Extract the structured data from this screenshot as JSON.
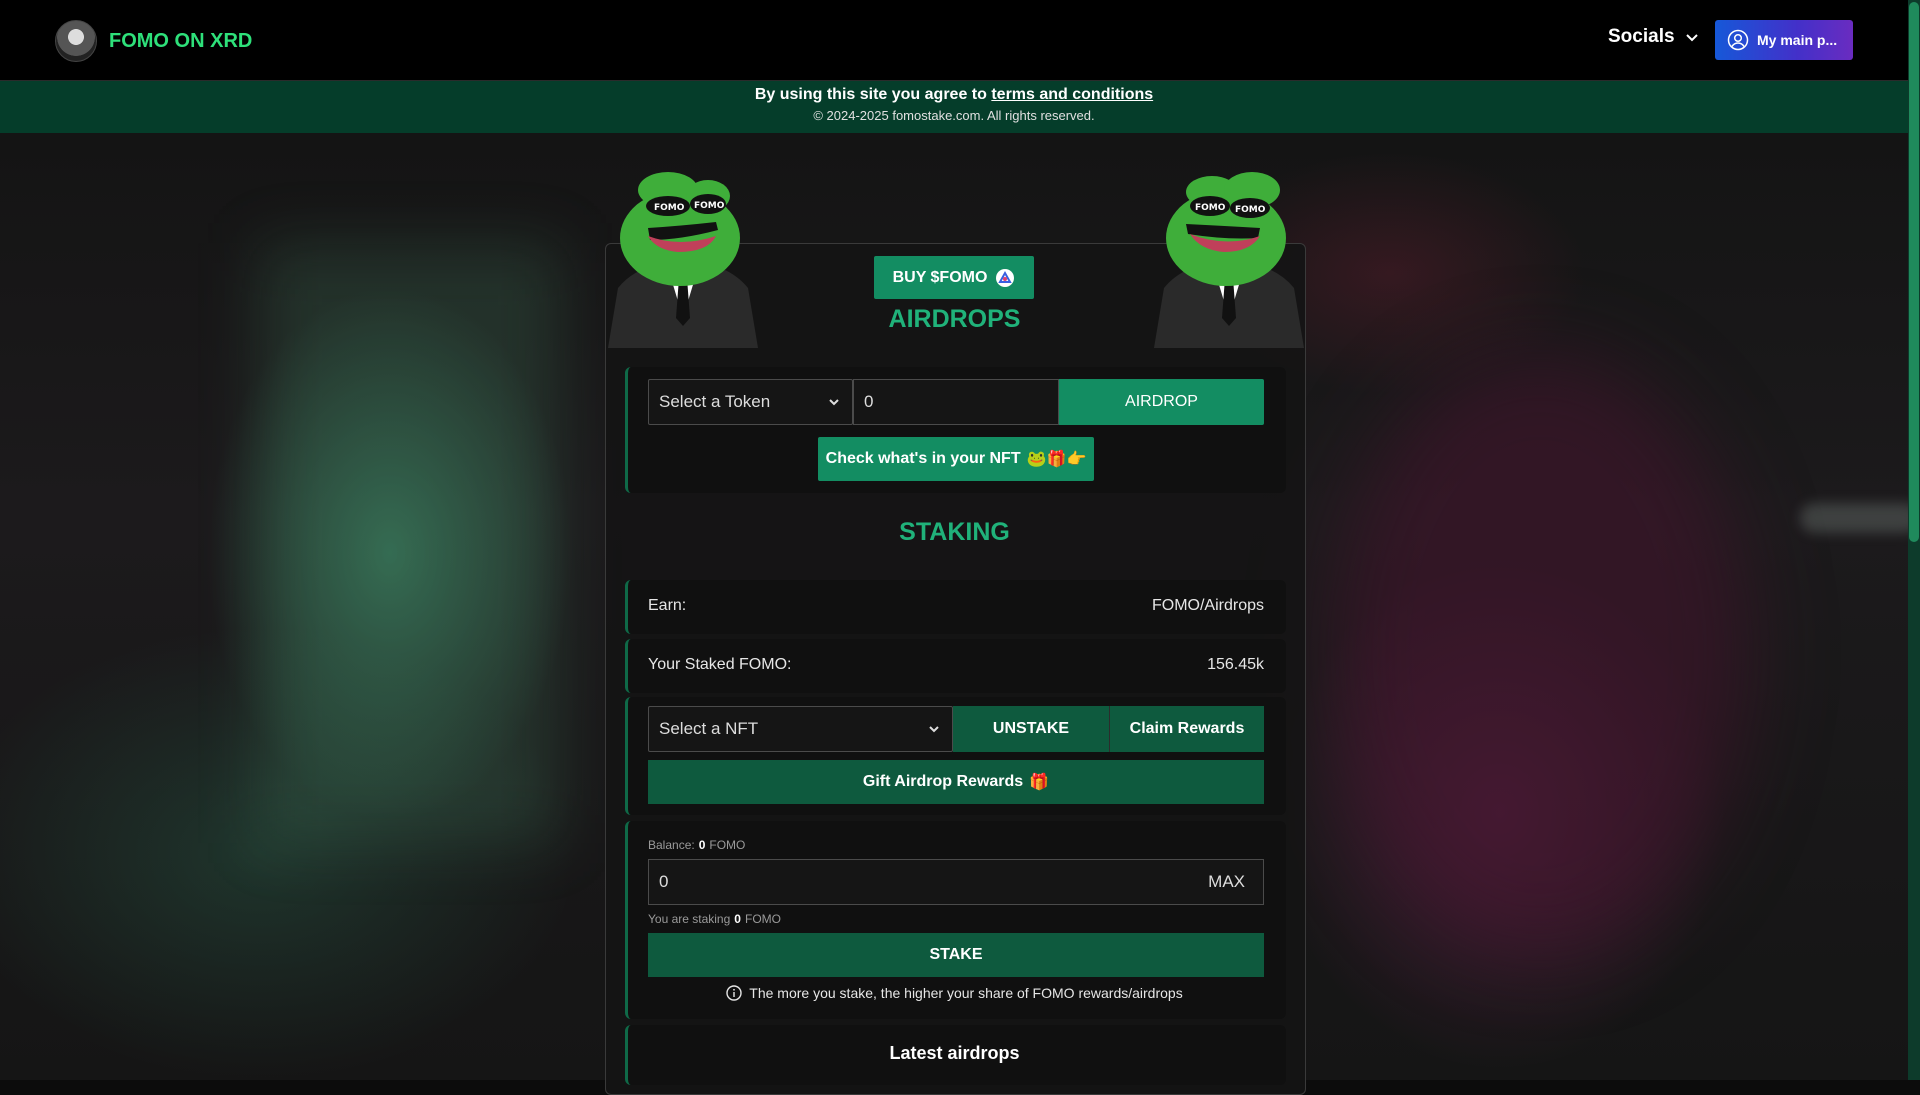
{
  "header": {
    "brand": "FOMO ON XRD",
    "socials_label": "Socials",
    "wallet_label": "My main p..."
  },
  "notice": {
    "prefix": "By using this site you agree to ",
    "link": "terms and conditions",
    "copyright": "© 2024-2025 fomostake.com. All rights reserved."
  },
  "buy": {
    "label": "BUY $FOMO"
  },
  "airdrops": {
    "title": "AIRDROPS",
    "token_select": "Select a Token",
    "amount_value": "0",
    "airdrop_button": "AIRDROP",
    "check_nft_label": "Check what's in your NFT",
    "check_nft_emojis": "🐸🎁👉"
  },
  "staking": {
    "title": "STAKING",
    "earn_label": "Earn:",
    "earn_value": "FOMO/Airdrops",
    "staked_label": "Your Staked FOMO:",
    "staked_value": "156.45k",
    "nft_select": "Select a NFT",
    "unstake_button": "UNSTAKE",
    "claim_button": "Claim Rewards",
    "gift_button": "Gift Airdrop Rewards",
    "gift_emoji": "🎁",
    "balance_label": "Balance:",
    "balance_value": "0",
    "balance_unit": "FOMO",
    "stake_input_value": "0",
    "max_label": "MAX",
    "staking_label": "You are staking",
    "staking_value": "0",
    "staking_unit": "FOMO",
    "stake_button": "STAKE",
    "info_text": "The more you stake, the higher your share of FOMO rewards/airdrops"
  },
  "latest": {
    "title": "Latest airdrops"
  },
  "colors": {
    "accent_green": "#20b27a",
    "button_green": "#138d62",
    "dark_button_green": "#0e5a3e",
    "brand_green": "#2ee07a",
    "notice_bg": "#053d2a"
  },
  "icons": [
    "chevron-down-icon",
    "user-circle-icon",
    "radix-logo-icon",
    "info-icon",
    "pepe-mascot"
  ]
}
